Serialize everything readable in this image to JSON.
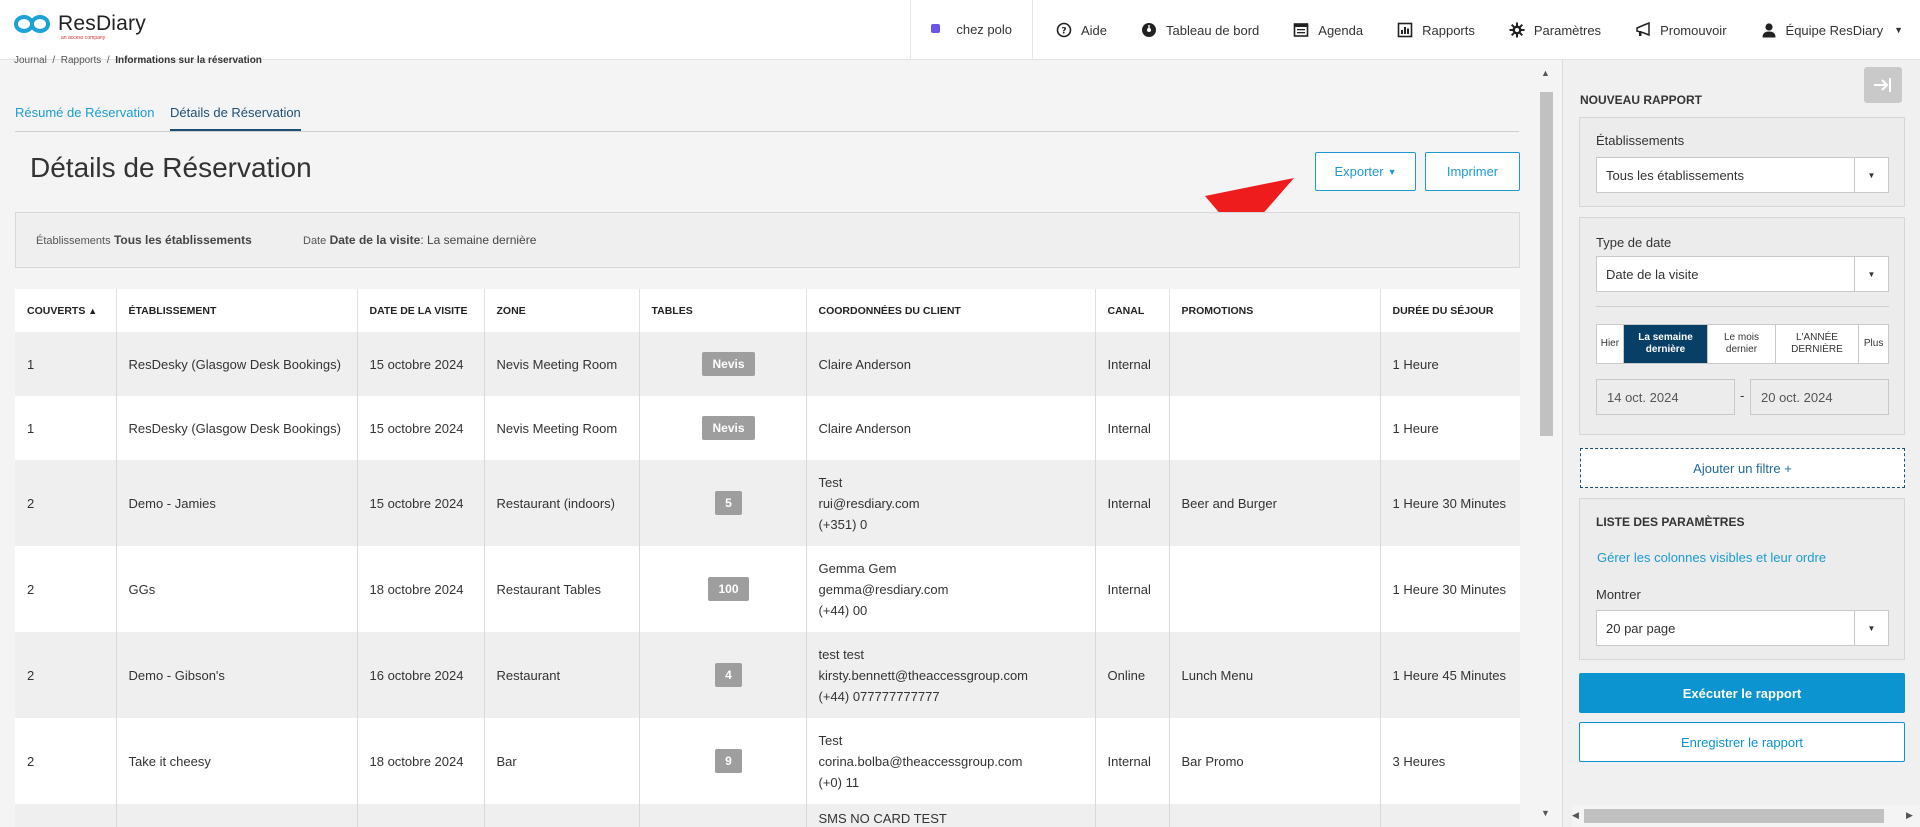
{
  "app": {
    "logo_text": "ResDiary",
    "logo_sub": "an access company"
  },
  "nav": {
    "site": "chez polo",
    "items": [
      {
        "label": "Aide",
        "icon": "help-icon"
      },
      {
        "label": "Tableau de bord",
        "icon": "dashboard-icon"
      },
      {
        "label": "Agenda",
        "icon": "agenda-icon"
      },
      {
        "label": "Rapports",
        "icon": "reports-icon"
      },
      {
        "label": "Paramètres",
        "icon": "gear-icon"
      },
      {
        "label": "Promouvoir",
        "icon": "megaphone-icon"
      },
      {
        "label": "Équipe ResDiary",
        "icon": "user-icon"
      }
    ]
  },
  "breadcrumb": {
    "items": [
      "Journal",
      "Rapports",
      "Informations sur la réservation"
    ]
  },
  "tabs": [
    {
      "label": "Résumé de Réservation"
    },
    {
      "label": "Détails de Réservation"
    }
  ],
  "page": {
    "title": "Détails de Réservation",
    "export_label": "Exporter",
    "print_label": "Imprimer"
  },
  "filters": {
    "establishments_label": "Établissements",
    "establishments_value": "Tous les établissements",
    "date_label": "Date",
    "date_type": "Date de la visite",
    "date_value": ": La semaine dernière"
  },
  "table": {
    "headers": [
      "COUVERTS",
      "ÉTABLISSEMENT",
      "DATE DE LA VISITE",
      "ZONE",
      "TABLES",
      "COORDONNÉES DU CLIENT",
      "CANAL",
      "PROMOTIONS",
      "DURÉE DU SÉJOUR"
    ],
    "sort_indicator": "▲",
    "rows": [
      {
        "covers": "1",
        "venue": "ResDesky (Glasgow Desk Bookings)",
        "date": "15 octobre 2024",
        "zone": "Nevis Meeting Room",
        "table": "Nevis",
        "client": [
          "Claire Anderson"
        ],
        "channel": "Internal",
        "promo": "",
        "duration": "1 Heure"
      },
      {
        "covers": "1",
        "venue": "ResDesky (Glasgow Desk Bookings)",
        "date": "15 octobre 2024",
        "zone": "Nevis Meeting Room",
        "table": "Nevis",
        "client": [
          "Claire Anderson"
        ],
        "channel": "Internal",
        "promo": "",
        "duration": "1 Heure"
      },
      {
        "covers": "2",
        "venue": "Demo - Jamies",
        "date": "15 octobre 2024",
        "zone": "Restaurant (indoors)",
        "table": "5",
        "client": [
          "Test",
          "rui@resdiary.com",
          "(+351) 0"
        ],
        "channel": "Internal",
        "promo": "Beer and Burger",
        "duration": "1 Heure 30 Minutes"
      },
      {
        "covers": "2",
        "venue": "GGs",
        "date": "18 octobre 2024",
        "zone": "Restaurant Tables",
        "table": "100",
        "client": [
          "Gemma Gem",
          "gemma@resdiary.com",
          "(+44) 00"
        ],
        "channel": "Internal",
        "promo": "",
        "duration": "1 Heure 30 Minutes"
      },
      {
        "covers": "2",
        "venue": "Demo - Gibson's",
        "date": "16 octobre 2024",
        "zone": "Restaurant",
        "table": "4",
        "client": [
          "test test",
          "kirsty.bennett@theaccessgroup.com",
          "(+44) 077777777777"
        ],
        "channel": "Online",
        "promo": "Lunch Menu",
        "duration": "1 Heure 45 Minutes"
      },
      {
        "covers": "2",
        "venue": "Take it cheesy",
        "date": "18 octobre 2024",
        "zone": "Bar",
        "table": "9",
        "client": [
          "Test",
          "corina.bolba@theaccessgroup.com",
          "(+0) 11"
        ],
        "channel": "Internal",
        "promo": "Bar Promo",
        "duration": "3 Heures"
      },
      {
        "covers": "",
        "venue": "",
        "date": "",
        "zone": "",
        "table": "",
        "client": [
          "SMS NO CARD TEST"
        ],
        "channel": "",
        "promo": "",
        "duration": ""
      }
    ]
  },
  "panel": {
    "title": "NOUVEAU RAPPORT",
    "establishments_label": "Établissements",
    "establishments_value": "Tous les établissements",
    "date_type_label": "Type de date",
    "date_type_value": "Date de la visite",
    "ranges": [
      "Hier",
      "La semaine dernière",
      "Le mois dernier",
      "L'ANNÉE DERNIÈRE",
      "Plus"
    ],
    "selected_range": "La semaine dernière",
    "date_from": "14 oct. 2024",
    "date_sep": "-",
    "date_to": "20 oct. 2024",
    "add_filter": "Ajouter un filtre +",
    "params_title": "LISTE DES PARAMÈTRES",
    "manage_columns": "Gérer les colonnes visibles et leur ordre",
    "show_label": "Montrer",
    "show_value": "20 par page",
    "run_label": "Exécuter le rapport",
    "save_label": "Enregistrer le rapport"
  },
  "colors": {
    "accent": "#1d9ad1",
    "dark_blue": "#073f66",
    "annotation": "#ee1c1c",
    "badge": "#9e9e9e"
  }
}
